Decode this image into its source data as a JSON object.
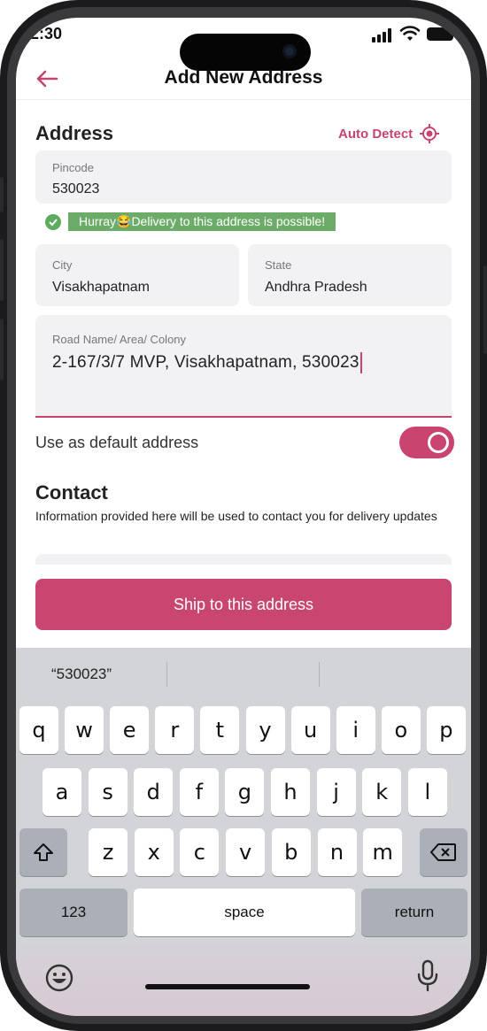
{
  "status_bar": {
    "time": "2:30"
  },
  "header": {
    "title": "Add New Address"
  },
  "address": {
    "section_title": "Address",
    "auto_detect_label": "Auto Detect",
    "pincode": {
      "label": "Pincode",
      "value": "530023"
    },
    "delivery_message": "Hurray😂Delivery to this address is possible!",
    "city": {
      "label": "City",
      "value": "Visakhapatnam"
    },
    "state": {
      "label": "State",
      "value": "Andhra Pradesh"
    },
    "road": {
      "label": "Road Name/ Area/ Colony",
      "value": "2-167/3/7 MVP, Visakhapatnam, 530023"
    },
    "default_label": "Use as default address",
    "default_enabled": true
  },
  "contact": {
    "section_title": "Contact",
    "description": "Information provided here will be used to contact you for delivery updates"
  },
  "ship_button_label": "Ship to this address",
  "keyboard": {
    "suggestion": "“530023”",
    "row1": [
      "q",
      "w",
      "e",
      "r",
      "t",
      "y",
      "u",
      "i",
      "o",
      "p"
    ],
    "row2": [
      "a",
      "s",
      "d",
      "f",
      "g",
      "h",
      "j",
      "k",
      "l"
    ],
    "row3": [
      "z",
      "x",
      "c",
      "v",
      "b",
      "n",
      "m"
    ],
    "numbers_label": "123",
    "space_label": "space",
    "return_label": "return"
  },
  "colors": {
    "accent": "#c8466f",
    "success": "#6dab68"
  }
}
